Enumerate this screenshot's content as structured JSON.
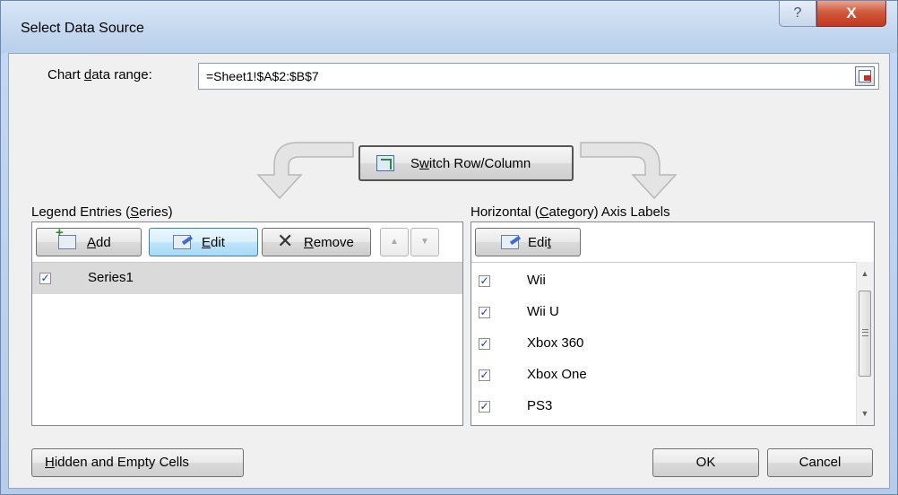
{
  "window": {
    "title": "Select Data Source",
    "help_label": "?",
    "close_label": "X"
  },
  "range": {
    "label_pre": "Chart ",
    "label_key": "d",
    "label_post": "ata range:",
    "value": "=Sheet1!$A$2:$B$7"
  },
  "switch": {
    "label_pre": "S",
    "label_key": "w",
    "label_post": "itch Row/Column"
  },
  "legend": {
    "label_pre": "Legend Entries (",
    "label_key": "S",
    "label_post": "eries)",
    "add": {
      "key": "A",
      "rest": "dd"
    },
    "edit": {
      "key": "E",
      "rest": "dit"
    },
    "remove": {
      "key": "R",
      "rest": "emove"
    },
    "up_label": "▲",
    "down_label": "▼",
    "series": [
      {
        "name": "Series1",
        "checked": true,
        "selected": true
      }
    ]
  },
  "axis": {
    "label_pre": "Horizontal (",
    "label_key": "C",
    "label_post": "ategory) Axis Labels",
    "edit": {
      "pre": "Edi",
      "key": "t"
    },
    "items": [
      {
        "name": "Wii",
        "checked": true
      },
      {
        "name": "Wii U",
        "checked": true
      },
      {
        "name": "Xbox 360",
        "checked": true
      },
      {
        "name": "Xbox One",
        "checked": true
      },
      {
        "name": "PS3",
        "checked": true
      }
    ],
    "scroll_up": "▲",
    "scroll_down": "▼"
  },
  "footer": {
    "hidden": {
      "key": "H",
      "rest": "idden and Empty Cells"
    },
    "ok_label": "OK",
    "cancel_label": "Cancel"
  },
  "checkmark": "✓",
  "colors": {
    "title_bar": "#c4d7ef",
    "client_bg": "#f0f0f0",
    "close_red": "#c0391e",
    "focus_blue": "#3c7fb1"
  }
}
